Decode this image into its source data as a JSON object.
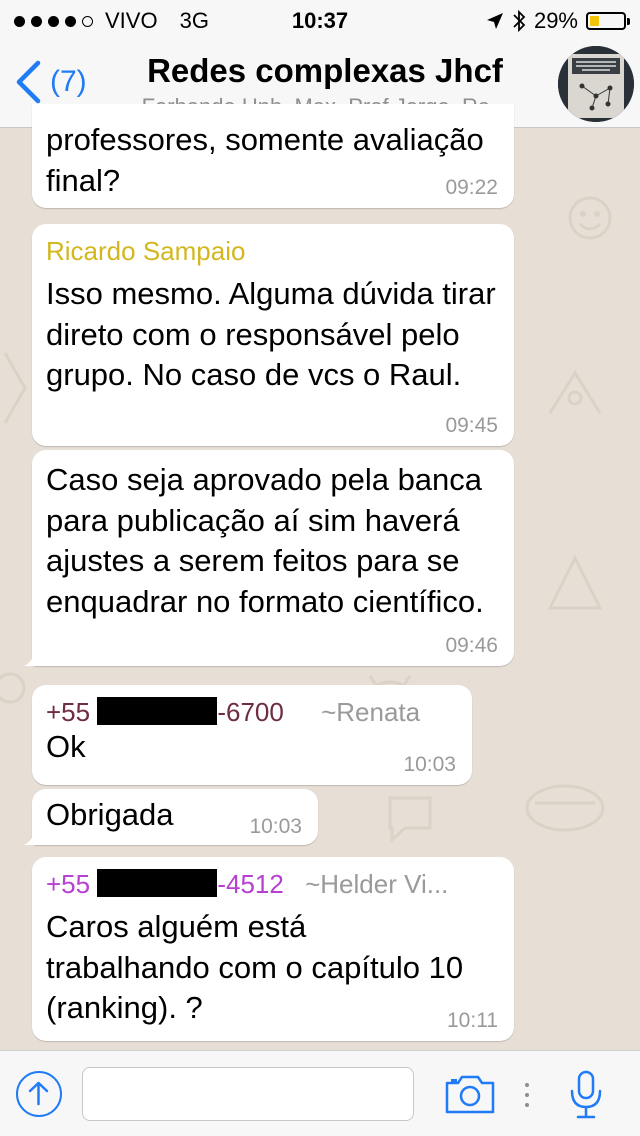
{
  "status_bar": {
    "carrier": "VIVO",
    "network": "3G",
    "time": "10:37",
    "battery": "29%",
    "battery_level": 0.29
  },
  "header": {
    "back_count": "(7)",
    "title": "Redes complexas Jhcf",
    "subtitle": "Ferbando Unb, Max, Prof Jorge, Ra..."
  },
  "messages": [
    {
      "text": "professores, somente avaliação final?",
      "time": "09:22"
    },
    {
      "sender": "Ricardo Sampaio",
      "text": "Isso mesmo. Alguma dúvida tirar direto com o responsável pelo grupo. No caso de vcs o Raul.",
      "time": "09:45"
    },
    {
      "text": "Caso seja aprovado pela banca para publicação aí sim haverá ajustes a serem feitos para se enquadrar no formato científico.",
      "time": "09:46"
    },
    {
      "sender_prefix": "+55",
      "sender_suffix": "-6700",
      "alias": "~Renata",
      "text": "Ok",
      "time": "10:03"
    },
    {
      "text": "Obrigada",
      "time": "10:03"
    },
    {
      "sender_prefix": "+55",
      "sender_suffix": "-4512",
      "alias": "~Helder Vi...",
      "text": "Caros alguém está trabalhando com o capítulo 10 (ranking). ?",
      "time": "10:11"
    }
  ],
  "colors": {
    "accent": "#1f7bf6",
    "sender_ricardo": "#d3b71f",
    "sender_renata": "#6e2d41",
    "sender_helder": "#b73fd1",
    "chat_background": "#e7dfd6"
  },
  "icons": {
    "back": "chevron-left-icon",
    "upload": "arrow-up-circle-icon",
    "camera": "camera-icon",
    "more": "vertical-dots-icon",
    "mic": "microphone-icon"
  }
}
